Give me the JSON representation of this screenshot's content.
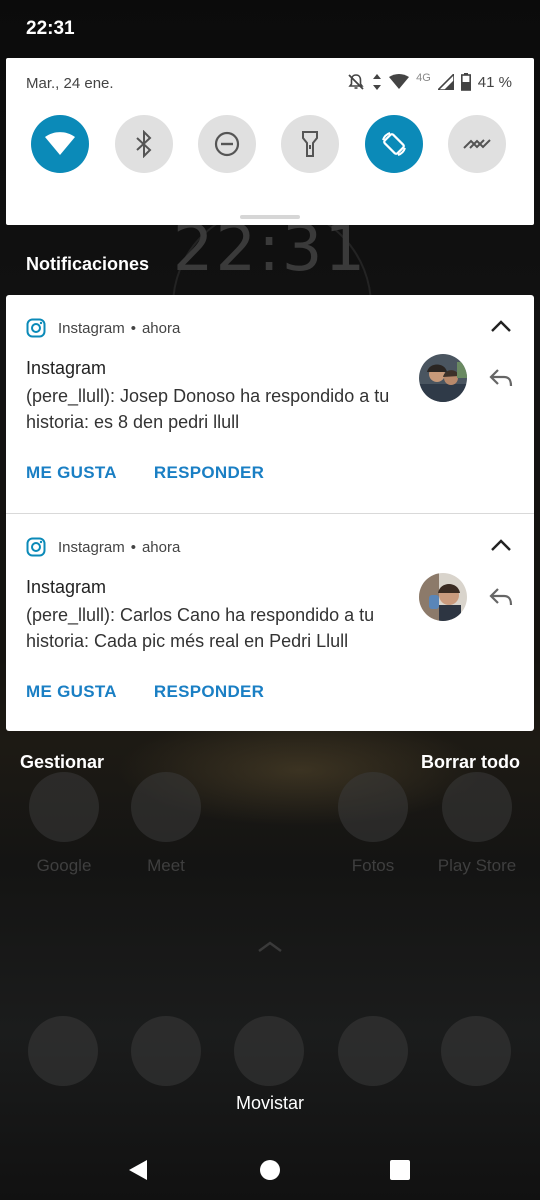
{
  "status_bar": {
    "time": "22:31"
  },
  "quick_settings": {
    "date": "Mar., 24 ene.",
    "network_type": "4G",
    "battery": "41 %",
    "tiles": [
      {
        "name": "wifi",
        "icon": "wifi-icon",
        "active": true
      },
      {
        "name": "bluetooth",
        "icon": "bluetooth-icon",
        "active": false
      },
      {
        "name": "do-not-disturb",
        "icon": "dnd-icon",
        "active": false
      },
      {
        "name": "flashlight",
        "icon": "flashlight-icon",
        "active": false
      },
      {
        "name": "auto-rotate",
        "icon": "rotate-icon",
        "active": true
      },
      {
        "name": "data-saver",
        "icon": "data-saver-icon",
        "active": false
      }
    ],
    "active_color": "#0b8ab8"
  },
  "wallpaper": {
    "clock": "22:31"
  },
  "notifications": {
    "header": "Notificaciones",
    "items": [
      {
        "app": "Instagram",
        "time": "ahora",
        "title": "Instagram",
        "text": "(pere_llull): Josep Donoso ha respondido a tu historia: es 8 den pedri llull",
        "actions": [
          "ME GUSTA",
          "RESPONDER"
        ]
      },
      {
        "app": "Instagram",
        "time": "ahora",
        "title": "Instagram",
        "text": "(pere_llull): Carlos Cano ha respondido a tu historia: Cada pic més real en Pedri Llull",
        "actions": [
          "ME GUSTA",
          "RESPONDER"
        ]
      }
    ],
    "action_color": "#1a7fc4"
  },
  "footer": {
    "manage": "Gestionar",
    "clear_all": "Borrar todo"
  },
  "home_apps": [
    "Google",
    "Meet",
    "Fotos",
    "Play Store"
  ],
  "carrier": "Movistar"
}
